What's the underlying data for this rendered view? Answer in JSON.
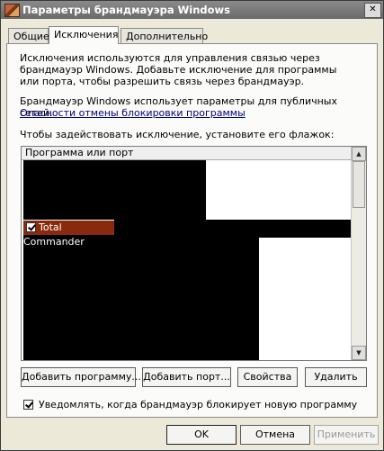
{
  "window": {
    "title": "Параметры брандмауэра Windows",
    "close_label": "✕"
  },
  "tabs": [
    {
      "label": "Общие",
      "active": false
    },
    {
      "label": "Исключения",
      "active": true
    },
    {
      "label": "Дополнительно",
      "active": false
    }
  ],
  "exceptions": {
    "description": "Исключения используются для управления связью через брандмауэр Windows. Добавьте исключение для программы или порта, чтобы разрешить связь через брандмауэр.",
    "profile_text": "Брандмауэр Windows использует параметры для публичных сетей.",
    "risk_link": "Опасности отмены блокировки программы",
    "list_instruction": "Чтобы задействовать исключение, установите его флажок:",
    "list_header": "Программа или порт",
    "list_items": [
      {
        "label": "Total Commander",
        "checked": true,
        "selected": true
      }
    ],
    "buttons": {
      "add_program": "Добавить программу...",
      "add_port": "Добавить порт...",
      "properties": "Свойства",
      "delete": "Удалить"
    },
    "notify_checkbox": {
      "label": "Уведомлять, когда брандмауэр блокирует новую программу",
      "checked": true
    }
  },
  "dialog_buttons": {
    "ok": "OK",
    "cancel": "Отмена",
    "apply": "Применить",
    "apply_disabled": true
  }
}
